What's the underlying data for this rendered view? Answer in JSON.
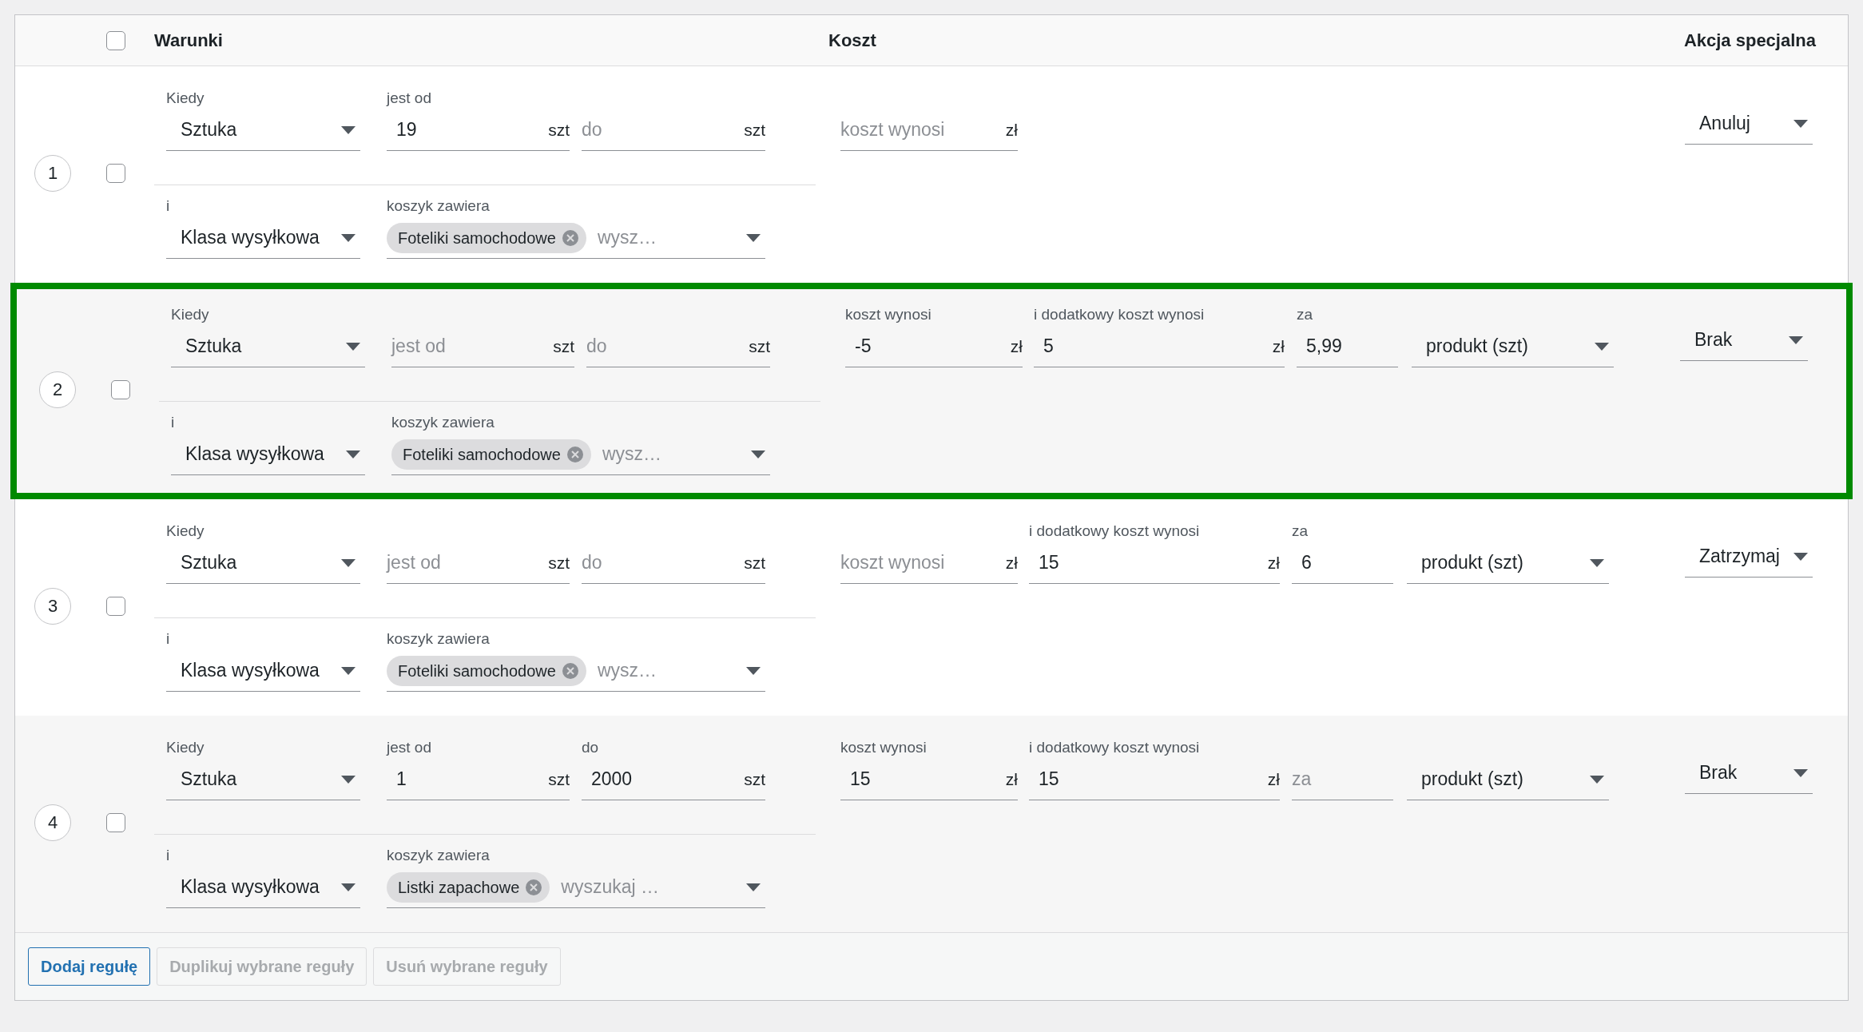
{
  "header": {
    "select_all_checked": false,
    "columns": [
      "Warunki",
      "Koszt",
      "Akcja specjalna"
    ]
  },
  "rules": [
    {
      "number": "1",
      "checked": false,
      "highlighted": false,
      "conditions": [
        {
          "kind": "select",
          "label": "Kiedy",
          "value": "Sztuka"
        },
        {
          "kind": "input",
          "label": "jest od",
          "value": "19",
          "unit": "szt"
        },
        {
          "kind": "input",
          "placeholder": "do",
          "unit": "szt"
        }
      ],
      "filters": [
        {
          "kind": "select",
          "label": "i",
          "value": "Klasa wysyłkowa"
        },
        {
          "kind": "tags",
          "label": "koszyk zawiera",
          "tags": [
            "Foteliki samochodowe"
          ],
          "placeholder": "wysz…"
        }
      ],
      "costs": [
        {
          "kind": "input",
          "placeholder": "koszt wynosi",
          "unit": "zł"
        }
      ],
      "action": "Anuluj"
    },
    {
      "number": "2",
      "checked": false,
      "highlighted": true,
      "conditions": [
        {
          "kind": "select",
          "label": "Kiedy",
          "value": "Sztuka"
        },
        {
          "kind": "input",
          "placeholder": "jest od",
          "unit": "szt"
        },
        {
          "kind": "input",
          "placeholder": "do",
          "unit": "szt"
        }
      ],
      "filters": [
        {
          "kind": "select",
          "label": "i",
          "value": "Klasa wysyłkowa"
        },
        {
          "kind": "tags",
          "label": "koszyk zawiera",
          "tags": [
            "Foteliki samochodowe"
          ],
          "placeholder": "wysz…"
        }
      ],
      "costs": [
        {
          "kind": "input",
          "label": "koszt wynosi",
          "value": "-5",
          "unit": "zł"
        },
        {
          "kind": "input",
          "label": "i dodatkowy koszt wynosi",
          "value": "5",
          "unit": "zł"
        },
        {
          "kind": "input",
          "label": "za",
          "value": "5,99"
        },
        {
          "kind": "select",
          "value": "produkt (szt)"
        }
      ],
      "action": "Brak"
    },
    {
      "number": "3",
      "checked": false,
      "highlighted": false,
      "conditions": [
        {
          "kind": "select",
          "label": "Kiedy",
          "value": "Sztuka"
        },
        {
          "kind": "input",
          "placeholder": "jest od",
          "unit": "szt"
        },
        {
          "kind": "input",
          "placeholder": "do",
          "unit": "szt"
        }
      ],
      "filters": [
        {
          "kind": "select",
          "label": "i",
          "value": "Klasa wysyłkowa"
        },
        {
          "kind": "tags",
          "label": "koszyk zawiera",
          "tags": [
            "Foteliki samochodowe"
          ],
          "placeholder": "wysz…"
        }
      ],
      "costs": [
        {
          "kind": "input",
          "placeholder": "koszt wynosi",
          "unit": "zł"
        },
        {
          "kind": "input",
          "label": "i dodatkowy koszt wynosi",
          "value": "15",
          "unit": "zł"
        },
        {
          "kind": "input",
          "label": "za",
          "value": "6"
        },
        {
          "kind": "select",
          "value": "produkt (szt)"
        }
      ],
      "action": "Zatrzymaj"
    },
    {
      "number": "4",
      "checked": false,
      "highlighted": false,
      "conditions": [
        {
          "kind": "select",
          "label": "Kiedy",
          "value": "Sztuka"
        },
        {
          "kind": "input",
          "label": "jest od",
          "value": "1",
          "unit": "szt"
        },
        {
          "kind": "input",
          "label": "do",
          "value": "2000",
          "unit": "szt"
        }
      ],
      "filters": [
        {
          "kind": "select",
          "label": "i",
          "value": "Klasa wysyłkowa"
        },
        {
          "kind": "tags",
          "label": "koszyk zawiera",
          "tags": [
            "Listki zapachowe"
          ],
          "placeholder": "wyszukaj …"
        }
      ],
      "costs": [
        {
          "kind": "input",
          "label": "koszt wynosi",
          "value": "15",
          "unit": "zł"
        },
        {
          "kind": "input",
          "label": "i dodatkowy koszt wynosi",
          "value": "15",
          "unit": "zł"
        },
        {
          "kind": "input",
          "placeholder": "za"
        },
        {
          "kind": "select",
          "value": "produkt (szt)"
        }
      ],
      "action": "Brak"
    }
  ],
  "buttons": [
    {
      "label": "Dodaj regułę",
      "disabled": false
    },
    {
      "label": "Duplikuj wybrane reguły",
      "disabled": true
    },
    {
      "label": "Usuń wybrane reguły",
      "disabled": true
    }
  ]
}
